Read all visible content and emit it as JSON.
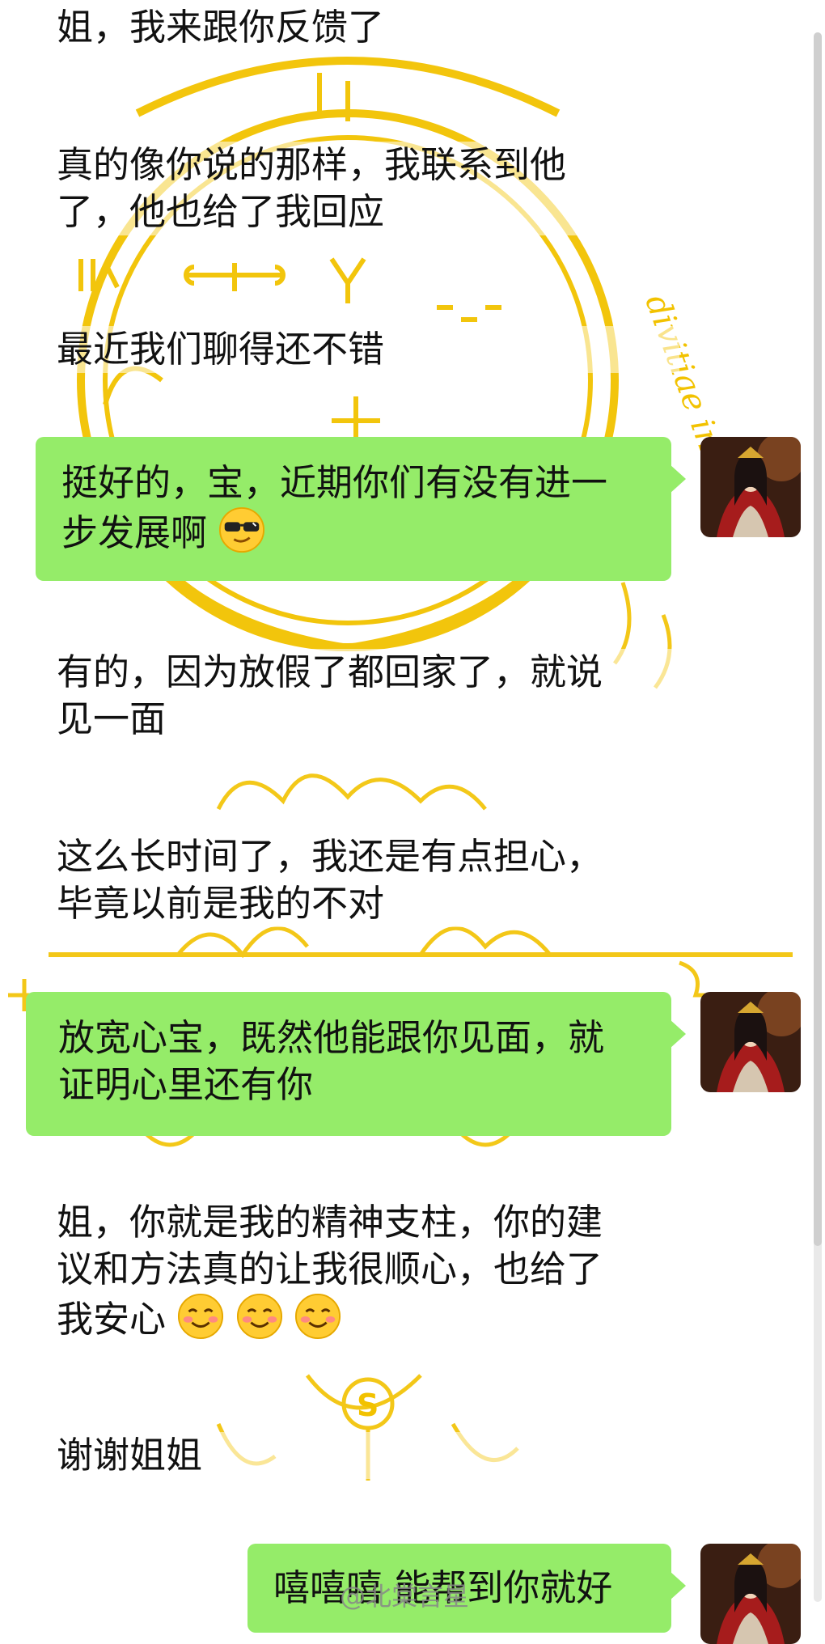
{
  "messages": {
    "m1": "姐，我来跟你反馈了",
    "m2a": "真的像你说的那样，我联系到他",
    "m2b": "了，他也给了我回应",
    "m3": "最近我们聊得还不错",
    "m4a": "挺好的，宝，近期你们有没有进一",
    "m4b": "步发展啊",
    "m5a": "有的，因为放假了都回家了，就说",
    "m5b": "见一面",
    "m6a": "这么长时间了，我还是有点担心，",
    "m6b": "毕竟以前是我的不对",
    "m7a": "放宽心宝，既然他能跟你见面，就",
    "m7b": "证明心里还有你",
    "m8a": "姐，你就是我的精神支柱，你的建",
    "m8b": "议和方法真的让我很顺心，也给了",
    "m8c": "我安心",
    "m9": "谢谢姐姐",
    "m10": "嘻嘻嘻 能帮到你就好"
  },
  "emojis": {
    "sunglasses": "sunglasses-emoji",
    "smiling": "smiling-blush-emoji"
  },
  "seal_text": "divitiae in a",
  "seal_letter": "S",
  "watermark": "@北棠言星",
  "colors": {
    "bubble_green": "#95ec69",
    "seal_gold": "#f2c200",
    "background": "#ffffff"
  }
}
